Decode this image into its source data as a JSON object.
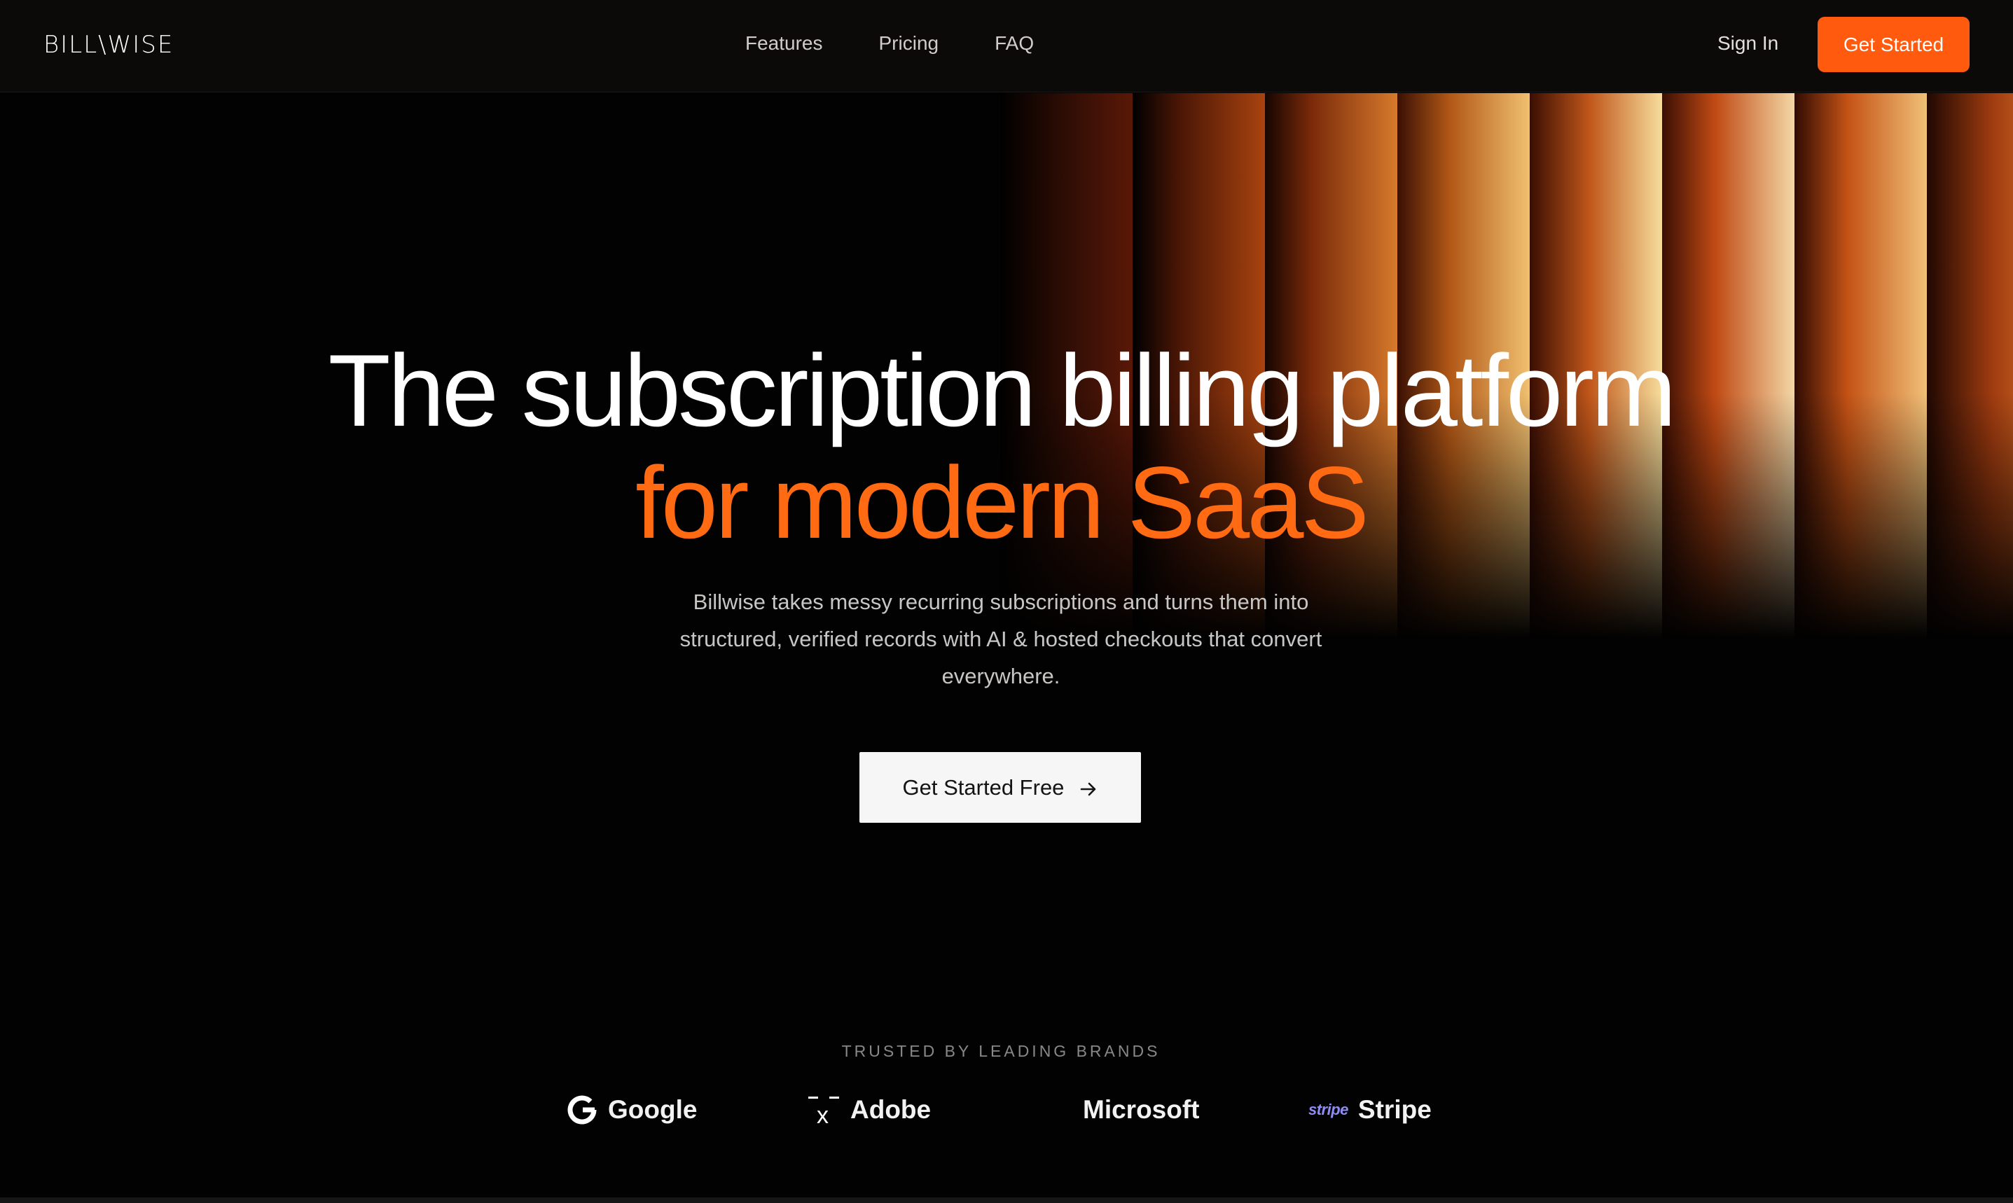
{
  "nav": {
    "logo": "BILL\\WISE",
    "links": [
      "Features",
      "Pricing",
      "FAQ"
    ],
    "sign_in": "Sign In",
    "cta": "Get Started"
  },
  "hero": {
    "title_line1": "The subscription billing platform",
    "title_line2": "for modern SaaS",
    "subtitle": "Billwise takes messy recurring subscriptions and turns them into structured, verified records with AI & hosted checkouts that convert everywhere.",
    "cta": "Get Started Free",
    "cta_icon": "arrow-right-icon"
  },
  "trusted": {
    "label": "TRUSTED BY LEADING BRANDS",
    "brands": [
      {
        "name": "Google",
        "icon": "google-icon"
      },
      {
        "name": "Adobe",
        "icon": "adobe-icon"
      },
      {
        "name": "Microsoft",
        "icon": "microsoft-icon"
      },
      {
        "name": "Stripe",
        "icon": "stripe-icon",
        "icon_text": "stripe"
      }
    ]
  },
  "colors": {
    "accent": "#ff5a0d",
    "title_accent": "#ff6a13",
    "background": "#020202",
    "nav_background": "#0c0a08",
    "stripe_brand": "#8f8cf5"
  }
}
